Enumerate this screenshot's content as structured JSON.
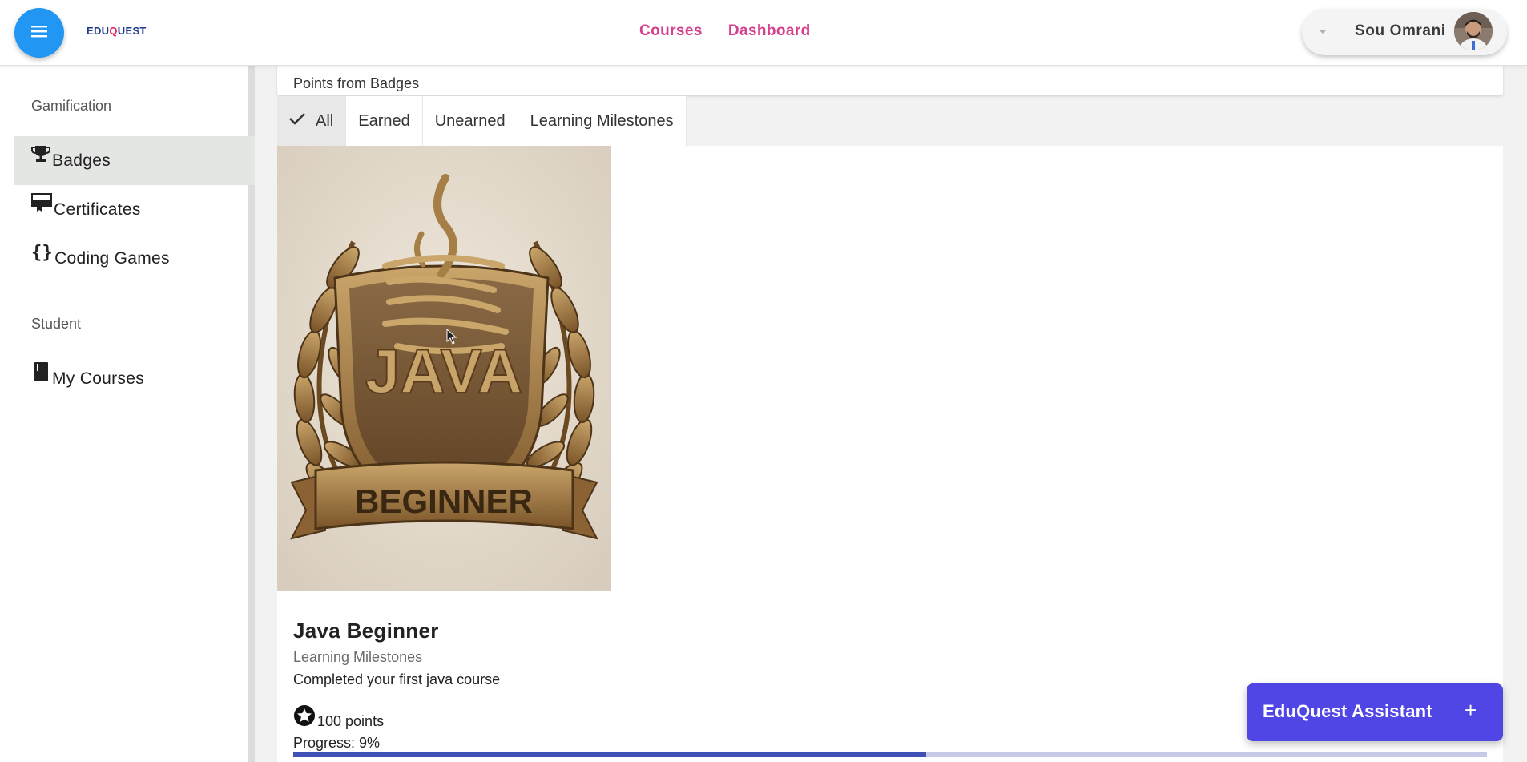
{
  "header": {
    "logo": {
      "part1": "EDU",
      "part2": "Q",
      "part3": "UEST"
    },
    "nav": [
      {
        "label": "Courses"
      },
      {
        "label": "Dashboard"
      }
    ],
    "user": {
      "name": "Sou Omrani",
      "avatar_icon": "user-avatar"
    },
    "menu_icon": "hamburger-icon"
  },
  "sidebar": {
    "sections": [
      {
        "label": "Gamification",
        "items": [
          {
            "label": "Badges",
            "icon": "trophy-icon",
            "active": true
          },
          {
            "label": "Certificates",
            "icon": "certificate-icon"
          },
          {
            "label": "Coding Games",
            "icon": "code-braces-icon"
          }
        ]
      },
      {
        "label": "Student",
        "items": [
          {
            "label": "My Courses",
            "icon": "book-icon"
          }
        ]
      }
    ]
  },
  "main": {
    "points_card_text": "Points from Badges",
    "filter_tabs": [
      {
        "label": "All",
        "selected": true
      },
      {
        "label": "Earned"
      },
      {
        "label": "Unearned"
      },
      {
        "label": "Learning Milestones"
      }
    ],
    "badge": {
      "image_text_top": "JAVA",
      "image_text_ribbon": "BEGINNER",
      "name": "Java Beginner",
      "category": "Learning Milestones",
      "description": "Completed your first java course",
      "points": "100 points",
      "progress_label": "Progress: 9%",
      "progress_bar_fraction": 0.53
    }
  },
  "assistant": {
    "label": "EduQuest Assistant",
    "plus": "+"
  },
  "colors": {
    "primary_blue": "#2196f3",
    "nav_pink": "#d63f8c",
    "assistant_indigo": "#4f46e5",
    "progress": "#3f51b5"
  }
}
